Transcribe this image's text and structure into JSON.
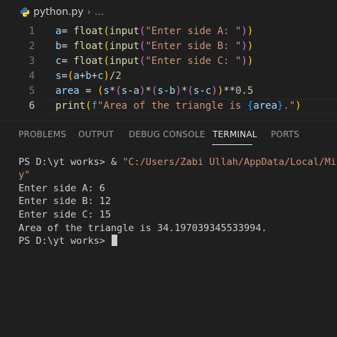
{
  "breadcrumb": {
    "file": "python.py",
    "separator": "›",
    "more": "..."
  },
  "editor": {
    "active_line": 6,
    "lines": [
      {
        "number": "1",
        "tokens": [
          [
            "var",
            "a"
          ],
          [
            "op",
            "= "
          ],
          [
            "fn",
            "float"
          ],
          [
            "br1",
            "("
          ],
          [
            "fn",
            "input"
          ],
          [
            "br2",
            "("
          ],
          [
            "str",
            "\"Enter side A: \""
          ],
          [
            "br2",
            ")"
          ],
          [
            "br1",
            ")"
          ]
        ]
      },
      {
        "number": "2",
        "tokens": [
          [
            "var",
            "b"
          ],
          [
            "op",
            "= "
          ],
          [
            "fn",
            "float"
          ],
          [
            "br1",
            "("
          ],
          [
            "fn",
            "input"
          ],
          [
            "br2",
            "("
          ],
          [
            "str",
            "\"Enter side B: \""
          ],
          [
            "br2",
            ")"
          ],
          [
            "br1",
            ")"
          ]
        ]
      },
      {
        "number": "3",
        "tokens": [
          [
            "var",
            "c"
          ],
          [
            "op",
            "= "
          ],
          [
            "fn",
            "float"
          ],
          [
            "br1",
            "("
          ],
          [
            "fn",
            "input"
          ],
          [
            "br2",
            "("
          ],
          [
            "str",
            "\"Enter side C: \""
          ],
          [
            "br2",
            ")"
          ],
          [
            "br1",
            ")"
          ]
        ]
      },
      {
        "number": "4",
        "tokens": [
          [
            "var",
            "s"
          ],
          [
            "op",
            "="
          ],
          [
            "br1",
            "("
          ],
          [
            "var",
            "a"
          ],
          [
            "op",
            "+"
          ],
          [
            "var",
            "b"
          ],
          [
            "op",
            "+"
          ],
          [
            "var",
            "c"
          ],
          [
            "br1",
            ")"
          ],
          [
            "op",
            "/"
          ],
          [
            "num",
            "2"
          ]
        ]
      },
      {
        "number": "5",
        "tokens": [
          [
            "var",
            "area"
          ],
          [
            "op",
            " = "
          ],
          [
            "br1",
            "("
          ],
          [
            "var",
            "s"
          ],
          [
            "op",
            "*"
          ],
          [
            "br2",
            "("
          ],
          [
            "var",
            "s"
          ],
          [
            "op",
            "-"
          ],
          [
            "var",
            "a"
          ],
          [
            "br2",
            ")"
          ],
          [
            "op",
            "*"
          ],
          [
            "br2",
            "("
          ],
          [
            "var",
            "s"
          ],
          [
            "op",
            "-"
          ],
          [
            "var",
            "b"
          ],
          [
            "br2",
            ")"
          ],
          [
            "op",
            "*"
          ],
          [
            "br2",
            "("
          ],
          [
            "var",
            "s"
          ],
          [
            "op",
            "-"
          ],
          [
            "var",
            "c"
          ],
          [
            "br2",
            ")"
          ],
          [
            "br1",
            ")"
          ],
          [
            "op",
            "**"
          ],
          [
            "num",
            "0.5"
          ]
        ]
      },
      {
        "number": "6",
        "tokens": [
          [
            "fn",
            "print"
          ],
          [
            "br1",
            "("
          ],
          [
            "kw",
            "f"
          ],
          [
            "str",
            "\"Area of the triangle is "
          ],
          [
            "br3",
            "{"
          ],
          [
            "var",
            "area"
          ],
          [
            "br3",
            "}"
          ],
          [
            "str",
            ".\""
          ],
          [
            "br1",
            ")"
          ]
        ]
      }
    ]
  },
  "panel": {
    "tabs": [
      {
        "label": "PROBLEMS",
        "active": false
      },
      {
        "label": "OUTPUT",
        "active": false
      },
      {
        "label": "DEBUG CONSOLE",
        "active": false
      },
      {
        "label": "TERMINAL",
        "active": true
      },
      {
        "label": "PORTS",
        "active": false
      }
    ]
  },
  "terminal": {
    "command_prompt": "PS D:\\yt works> ",
    "command_amp": "& ",
    "command_path": "\"C:/Users/Zabi Ullah/AppData/Local/Micro",
    "command_wrap": "y\"",
    "output": [
      "Enter side A: 6",
      "Enter side B: 12",
      "Enter side C: 15",
      "Area of the triangle is 34.197039345533994."
    ],
    "final_prompt": "PS D:\\yt works> "
  },
  "colors": {
    "background": "#1f1f1f",
    "string": "#ce9178",
    "function": "#dcdcaa",
    "variable": "#9cdcfe",
    "python_blue": "#3776ab",
    "python_yellow": "#ffd43b"
  }
}
